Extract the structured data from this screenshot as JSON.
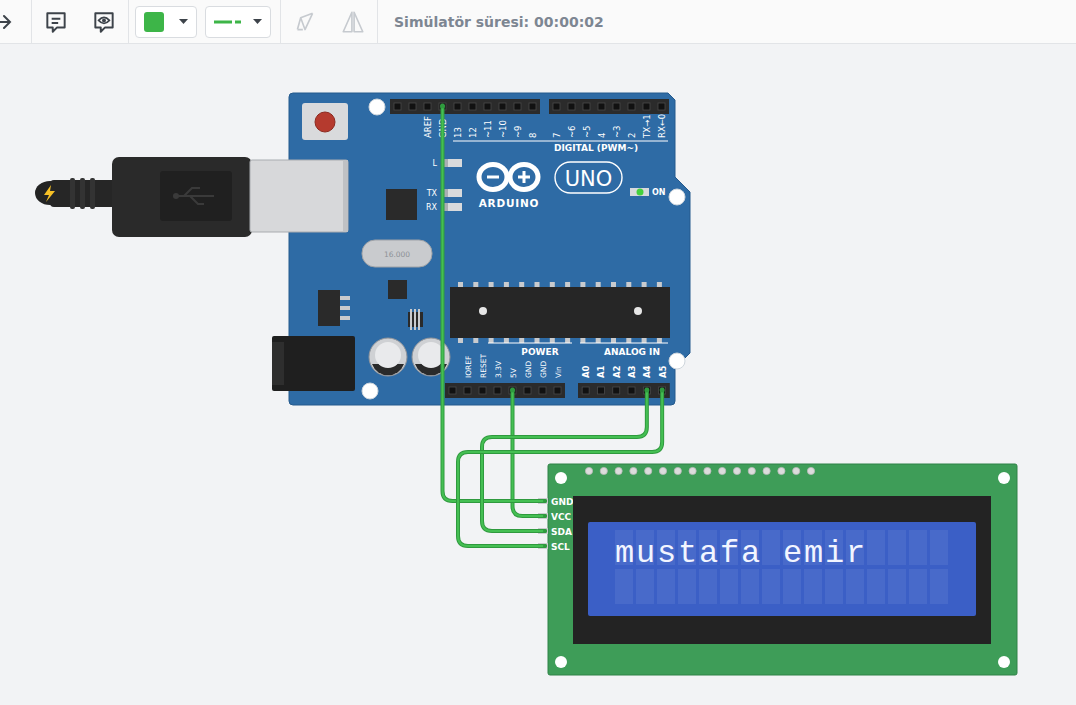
{
  "toolbar": {
    "tools": [
      {
        "kind": "arrow",
        "disabled": false
      },
      {
        "kind": "note",
        "disabled": false
      },
      {
        "kind": "eye",
        "disabled": false
      }
    ],
    "fill_color": "#3db548",
    "line_color": "#3db548",
    "edit_tools": [
      {
        "kind": "pen",
        "disabled": true
      },
      {
        "kind": "flip",
        "disabled": true
      }
    ],
    "sim_time": "Simülatör süresi: 00:00:02"
  },
  "board": {
    "digital_pins": [
      "AREF",
      "GND",
      "13",
      "12",
      "~11",
      "~10",
      "~9",
      "8",
      "7",
      "~6",
      "~5",
      "4",
      "~3",
      "2",
      "TX→1",
      "RX←0"
    ],
    "digital_header": "DIGITAL (PWM~)",
    "leds": [
      {
        "label": "L",
        "on": false
      },
      {
        "label": "TX",
        "on": false
      },
      {
        "label": "RX",
        "on": false
      }
    ],
    "power_led": {
      "label": "ON",
      "on": true
    },
    "logo": "ARDUINO",
    "model": "UNO",
    "crystal": "16.000",
    "power_pins": [
      "IOREF",
      "RESET",
      "3.3V",
      "5V",
      "GND",
      "GND",
      "Vin"
    ],
    "power_header": "POWER",
    "analog_pins": [
      "A0",
      "A1",
      "A2",
      "A3",
      "A4",
      "A5"
    ],
    "analog_header": "ANALOG IN"
  },
  "lcd": {
    "pins": [
      "GND",
      "VCC",
      "SDA",
      "SCL"
    ],
    "text": "mustafa emir"
  },
  "wires": [
    {
      "from": "5V",
      "to": "VCC"
    },
    {
      "from": "GND",
      "to": "GND"
    },
    {
      "from": "A4",
      "to": "SDA"
    },
    {
      "from": "A5",
      "to": "SCL"
    }
  ]
}
